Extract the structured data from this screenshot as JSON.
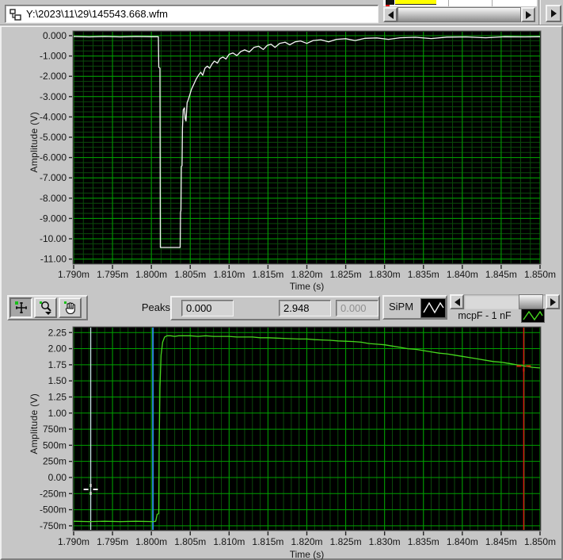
{
  "top_bar": {
    "path_value": "Y:\\2023\\11\\29\\145543.668.wfm"
  },
  "toolbar": {
    "peaks_label": "Peaks",
    "peaks": [
      "0.000",
      "2.948",
      "0.000"
    ],
    "legends": [
      {
        "label": "SiPM",
        "color": "#f5f5f5"
      },
      {
        "label": "mcpF - 1 nF",
        "color": "#46d81e"
      }
    ]
  },
  "chart_data": [
    {
      "id": "chart1",
      "type": "line",
      "title": "",
      "xlabel": "Time (s)",
      "ylabel": "Amplitude (V)",
      "xlim": [
        1790,
        1850
      ],
      "ylim": [
        -11.21,
        0.195
      ],
      "x_ticks": {
        "values": [
          1790,
          1795,
          1800,
          1805,
          1810,
          1815,
          1820,
          1825,
          1830,
          1835,
          1840,
          1845,
          1850
        ],
        "labels": [
          "1.790m",
          "1.795m",
          "1.800m",
          "1.805m",
          "1.810m",
          "1.815m",
          "1.820m",
          "1.825m",
          "1.830m",
          "1.835m",
          "1.840m",
          "1.845m",
          "1.850m"
        ]
      },
      "y_ticks": {
        "values": [
          0,
          -1,
          -2,
          -3,
          -4,
          -5,
          -6,
          -7,
          -8,
          -9,
          -10,
          -11
        ],
        "labels": [
          "0.000",
          "-1.000",
          "-2.000",
          "-3.000",
          "-4.000",
          "-5.000",
          "-6.000",
          "-7.000",
          "-8.000",
          "-9.000",
          "-10.00",
          "-11.00"
        ]
      },
      "grid": {
        "x_minor_step": 1.25,
        "y_minor_step": 0.25,
        "major_color": "#00a000",
        "minor_color": "#0b4a0b",
        "bg": "#000000"
      },
      "series": [
        {
          "name": "SiPM",
          "color": "#f5f5f5",
          "points": [
            [
              1790,
              -0.04
            ],
            [
              1792,
              -0.06
            ],
            [
              1794,
              -0.04
            ],
            [
              1796,
              -0.06
            ],
            [
              1798,
              -0.04
            ],
            [
              1800.2,
              -0.05
            ],
            [
              1800.9,
              -0.05
            ],
            [
              1800.95,
              -1.55
            ],
            [
              1801.1,
              -1.6
            ],
            [
              1801.15,
              -10.43
            ],
            [
              1803.7,
              -10.43
            ],
            [
              1803.75,
              -8.7
            ],
            [
              1803.8,
              -8.6
            ],
            [
              1803.85,
              -6.45
            ],
            [
              1803.95,
              -6.4
            ],
            [
              1804.0,
              -4.55
            ],
            [
              1804.1,
              -3.65
            ],
            [
              1804.25,
              -3.55
            ],
            [
              1804.35,
              -4.1
            ],
            [
              1804.45,
              -4.2
            ],
            [
              1804.6,
              -3.3
            ],
            [
              1804.75,
              -3.15
            ],
            [
              1804.95,
              -2.9
            ],
            [
              1805.15,
              -2.65
            ],
            [
              1805.45,
              -2.4
            ],
            [
              1805.75,
              -2.15
            ],
            [
              1806.05,
              -1.95
            ],
            [
              1806.35,
              -1.8
            ],
            [
              1806.6,
              -1.95
            ],
            [
              1806.9,
              -1.6
            ],
            [
              1807.2,
              -1.5
            ],
            [
              1807.5,
              -1.6
            ],
            [
              1807.8,
              -1.4
            ],
            [
              1808.1,
              -1.25
            ],
            [
              1808.5,
              -1.35
            ],
            [
              1808.85,
              -1.12
            ],
            [
              1809.2,
              -1.05
            ],
            [
              1809.6,
              -1.15
            ],
            [
              1810,
              -0.92
            ],
            [
              1810.5,
              -0.85
            ],
            [
              1811,
              -0.98
            ],
            [
              1811.5,
              -0.78
            ],
            [
              1812,
              -0.7
            ],
            [
              1812.6,
              -0.8
            ],
            [
              1813.2,
              -0.58
            ],
            [
              1813.8,
              -0.52
            ],
            [
              1814.4,
              -0.68
            ],
            [
              1814.9,
              -0.48
            ],
            [
              1815.4,
              -0.42
            ],
            [
              1815.9,
              -0.58
            ],
            [
              1816.5,
              -0.38
            ],
            [
              1817.2,
              -0.32
            ],
            [
              1817.8,
              -0.45
            ],
            [
              1818.5,
              -0.3
            ],
            [
              1819.2,
              -0.26
            ],
            [
              1820,
              -0.38
            ],
            [
              1820.8,
              -0.24
            ],
            [
              1821.8,
              -0.2
            ],
            [
              1822.8,
              -0.3
            ],
            [
              1823.8,
              -0.18
            ],
            [
              1825,
              -0.15
            ],
            [
              1826.2,
              -0.24
            ],
            [
              1827.5,
              -0.13
            ],
            [
              1829,
              -0.11
            ],
            [
              1830.5,
              -0.18
            ],
            [
              1832,
              -0.1
            ],
            [
              1834,
              -0.08
            ],
            [
              1836,
              -0.14
            ],
            [
              1838,
              -0.07
            ],
            [
              1840.5,
              -0.06
            ],
            [
              1843,
              -0.1
            ],
            [
              1845.5,
              -0.05
            ],
            [
              1848,
              -0.06
            ],
            [
              1850,
              -0.05
            ]
          ]
        }
      ],
      "cursors": []
    },
    {
      "id": "chart2",
      "type": "line",
      "title": "",
      "xlabel": "Time (s)",
      "ylabel": "Amplitude (V)",
      "xlim": [
        1790,
        1850
      ],
      "ylim": [
        -0.813,
        2.327
      ],
      "x_ticks": {
        "values": [
          1790,
          1795,
          1800,
          1805,
          1810,
          1815,
          1820,
          1825,
          1830,
          1835,
          1840,
          1845,
          1850
        ],
        "labels": [
          "1.790m",
          "1.795m",
          "1.800m",
          "1.805m",
          "1.810m",
          "1.815m",
          "1.820m",
          "1.825m",
          "1.830m",
          "1.835m",
          "1.840m",
          "1.845m",
          "1.850m"
        ]
      },
      "y_ticks": {
        "values": [
          2.25,
          2.0,
          1.75,
          1.5,
          1.25,
          1.0,
          0.75,
          0.5,
          0.25,
          0.0,
          -0.25,
          -0.5,
          -0.75
        ],
        "labels": [
          "2.25",
          "2.00",
          "1.75",
          "1.50",
          "1.25",
          "1.00",
          "750m",
          "500m",
          "250m",
          "0.00",
          "-250m",
          "-500m",
          "-750m"
        ]
      },
      "grid": {
        "x_minor_step": 1.0,
        "y_minor_step": null,
        "major_color": "#00a000",
        "minor_color": "#0b4a0b",
        "bg": "#000000"
      },
      "series": [
        {
          "name": "mcpF - 1 nF",
          "color": "#46d81e",
          "points": [
            [
              1790,
              -0.68
            ],
            [
              1792,
              -0.685
            ],
            [
              1794,
              -0.68
            ],
            [
              1796,
              -0.685
            ],
            [
              1798,
              -0.68
            ],
            [
              1800.3,
              -0.685
            ],
            [
              1800.55,
              -0.68
            ],
            [
              1800.75,
              -0.57
            ],
            [
              1800.95,
              -0.56
            ],
            [
              1801.0,
              0.5
            ],
            [
              1801.1,
              1.4
            ],
            [
              1801.25,
              1.9
            ],
            [
              1801.45,
              2.1
            ],
            [
              1801.7,
              2.18
            ],
            [
              1802,
              2.2
            ],
            [
              1802.5,
              2.2
            ],
            [
              1803,
              2.19
            ],
            [
              1803.5,
              2.2
            ],
            [
              1804,
              2.2
            ],
            [
              1805,
              2.2
            ],
            [
              1806,
              2.19
            ],
            [
              1807,
              2.2
            ],
            [
              1808,
              2.19
            ],
            [
              1809,
              2.19
            ],
            [
              1810,
              2.19
            ],
            [
              1811,
              2.18
            ],
            [
              1812,
              2.18
            ],
            [
              1813,
              2.18
            ],
            [
              1814,
              2.17
            ],
            [
              1815,
              2.17
            ],
            [
              1816,
              2.165
            ],
            [
              1817,
              2.16
            ],
            [
              1818,
              2.155
            ],
            [
              1819,
              2.15
            ],
            [
              1820,
              2.15
            ],
            [
              1821,
              2.14
            ],
            [
              1822,
              2.135
            ],
            [
              1823,
              2.13
            ],
            [
              1824,
              2.12
            ],
            [
              1825,
              2.115
            ],
            [
              1826,
              2.11
            ],
            [
              1827,
              2.1
            ],
            [
              1828,
              2.08
            ],
            [
              1829,
              2.07
            ],
            [
              1830,
              2.06
            ],
            [
              1831,
              2.04
            ],
            [
              1832,
              2.02
            ],
            [
              1833,
              2.0
            ],
            [
              1834,
              1.99
            ],
            [
              1835,
              1.97
            ],
            [
              1836,
              1.95
            ],
            [
              1837,
              1.93
            ],
            [
              1838,
              1.92
            ],
            [
              1839,
              1.9
            ],
            [
              1840,
              1.88
            ],
            [
              1841,
              1.86
            ],
            [
              1842,
              1.84
            ],
            [
              1843,
              1.82
            ],
            [
              1844,
              1.8
            ],
            [
              1845,
              1.79
            ],
            [
              1846,
              1.77
            ],
            [
              1847,
              1.75
            ],
            [
              1848,
              1.73
            ],
            [
              1849,
              1.71
            ],
            [
              1850,
              1.7
            ]
          ]
        }
      ],
      "cursors": [
        {
          "name": "cursor-1",
          "x": 1792.2,
          "color": "#cdeaea",
          "width": 1.2,
          "marker": {
            "x": 1792.2,
            "y": -0.185,
            "color": "#f0f0f0"
          }
        },
        {
          "name": "cursor-2",
          "x": 1800.2,
          "color": "#2a87d8",
          "width": 2
        },
        {
          "name": "cursor-3",
          "x": 1847.9,
          "color": "#d81c10",
          "width": 1.4,
          "marker": {
            "x": 1847.9,
            "y": 1.73,
            "color": "#d81c10"
          }
        }
      ]
    }
  ]
}
